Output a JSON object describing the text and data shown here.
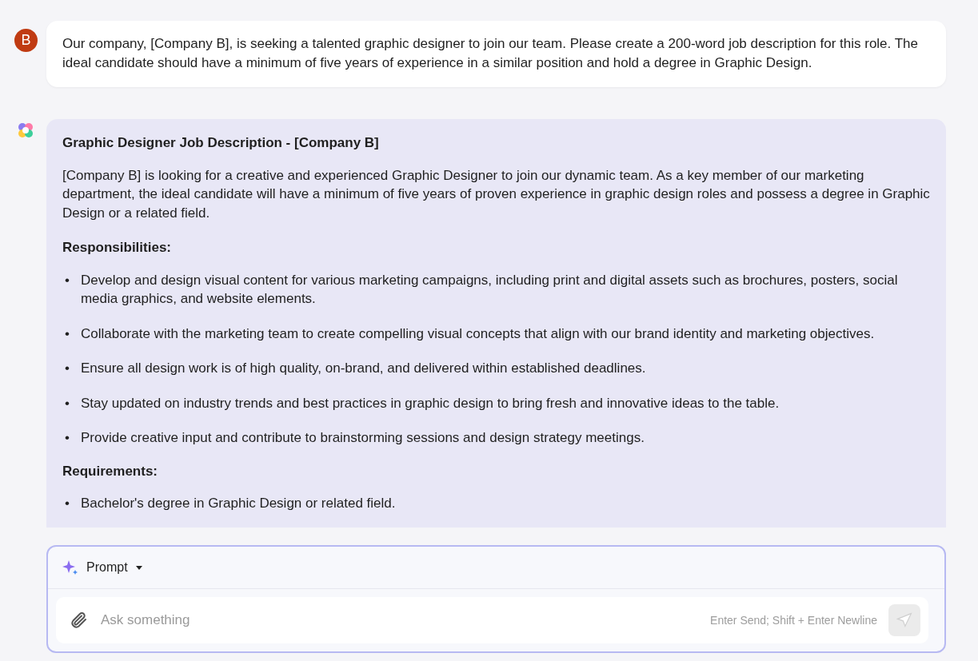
{
  "user_message": {
    "avatar": "B",
    "text": "Our company, [Company B], is seeking a talented graphic designer to join our team. Please create a 200-word job description for this role. The ideal candidate should have a minimum of five years of experience in a similar position and hold a degree in Graphic Design."
  },
  "response": {
    "blocks": [
      {
        "kind": "heading",
        "text": "Graphic Designer Job Description - [Company B]"
      },
      {
        "kind": "paragraph",
        "text": "[Company B] is looking for a creative and experienced Graphic Designer to join our dynamic team. As a key member of our marketing department, the ideal candidate will have a minimum of five years of proven experience in graphic design roles and possess a degree in Graphic Design or a related field."
      },
      {
        "kind": "heading",
        "text": "Responsibilities:"
      },
      {
        "kind": "list",
        "items": [
          {
            "bullet": "•",
            "text": "Develop and design visual content for various marketing campaigns, including print and digital assets such as brochures, posters, social media graphics, and website elements."
          },
          {
            "bullet": "•",
            "text": "Collaborate with the marketing team to create compelling visual concepts that align with our brand identity and marketing objectives."
          },
          {
            "bullet": "•",
            "text": "Ensure all design work is of high quality, on-brand, and delivered within established deadlines."
          },
          {
            "bullet": "•",
            "text": "Stay updated on industry trends and best practices in graphic design to bring fresh and innovative ideas to the table."
          },
          {
            "bullet": "•",
            "text": "Provide creative input and contribute to brainstorming sessions and design strategy meetings."
          }
        ]
      },
      {
        "kind": "heading",
        "text": "Requirements:"
      },
      {
        "kind": "list",
        "items": [
          {
            "bullet": "•",
            "text": "Bachelor's degree in Graphic Design or related field."
          }
        ]
      }
    ]
  },
  "composer": {
    "mode": "Prompt",
    "placeholder": "Ask something",
    "hint": "Enter Send; Shift + Enter Newline",
    "send_disabled": true
  }
}
